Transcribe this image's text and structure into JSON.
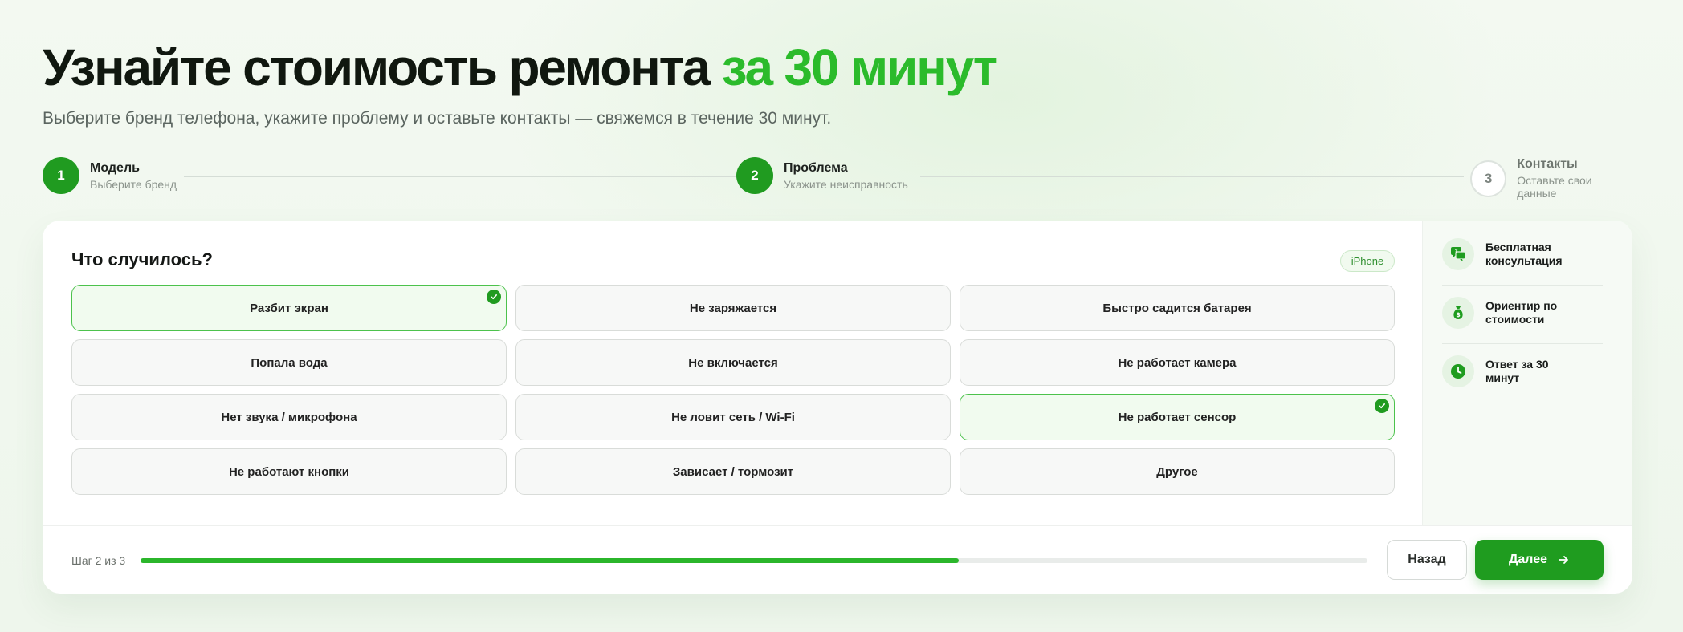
{
  "hero": {
    "title_main": "Узнайте стоимость ремонта ",
    "title_accent": "за 30 минут",
    "subtitle": "Выберите бренд телефона, укажите проблему и оставьте контакты — свяжемся в течение 30 минут."
  },
  "steps": [
    {
      "number": "1",
      "title": "Модель",
      "subtitle": "Выберите бренд",
      "state": "done"
    },
    {
      "number": "2",
      "title": "Проблема",
      "subtitle": "Укажите неисправность",
      "state": "active"
    },
    {
      "number": "3",
      "title": "Контакты",
      "subtitle": "Оставьте свои данные",
      "state": "pending"
    }
  ],
  "question": {
    "title": "Что случилось?",
    "badge": "iPhone"
  },
  "options": [
    {
      "label": "Разбит экран",
      "selected": true
    },
    {
      "label": "Не заряжается",
      "selected": false
    },
    {
      "label": "Быстро садится батарея",
      "selected": false
    },
    {
      "label": "Попала вода",
      "selected": false
    },
    {
      "label": "Не включается",
      "selected": false
    },
    {
      "label": "Не работает камера",
      "selected": false
    },
    {
      "label": "Нет звука / микрофона",
      "selected": false
    },
    {
      "label": "Не ловит сеть / Wi-Fi",
      "selected": false
    },
    {
      "label": "Не работает сенсор",
      "selected": true
    },
    {
      "label": "Не работают кнопки",
      "selected": false
    },
    {
      "label": "Зависает / тормозит",
      "selected": false
    },
    {
      "label": "Другое",
      "selected": false
    }
  ],
  "side": {
    "items": [
      {
        "label": "Бесплатная консультация",
        "icon": "chat-question-icon"
      },
      {
        "label": "Ориентир по стоимости",
        "icon": "money-bag-icon"
      },
      {
        "label": "Ответ за 30 минут",
        "icon": "clock-icon"
      }
    ]
  },
  "footer": {
    "step_text": "Шаг 2 из 3",
    "progress": 0.667,
    "back_label": "Назад",
    "next_label": "Далее"
  },
  "colors": {
    "accent": "#2bbb2b",
    "primary_button": "#1f9c1f",
    "selected_border": "#4cc24c"
  }
}
